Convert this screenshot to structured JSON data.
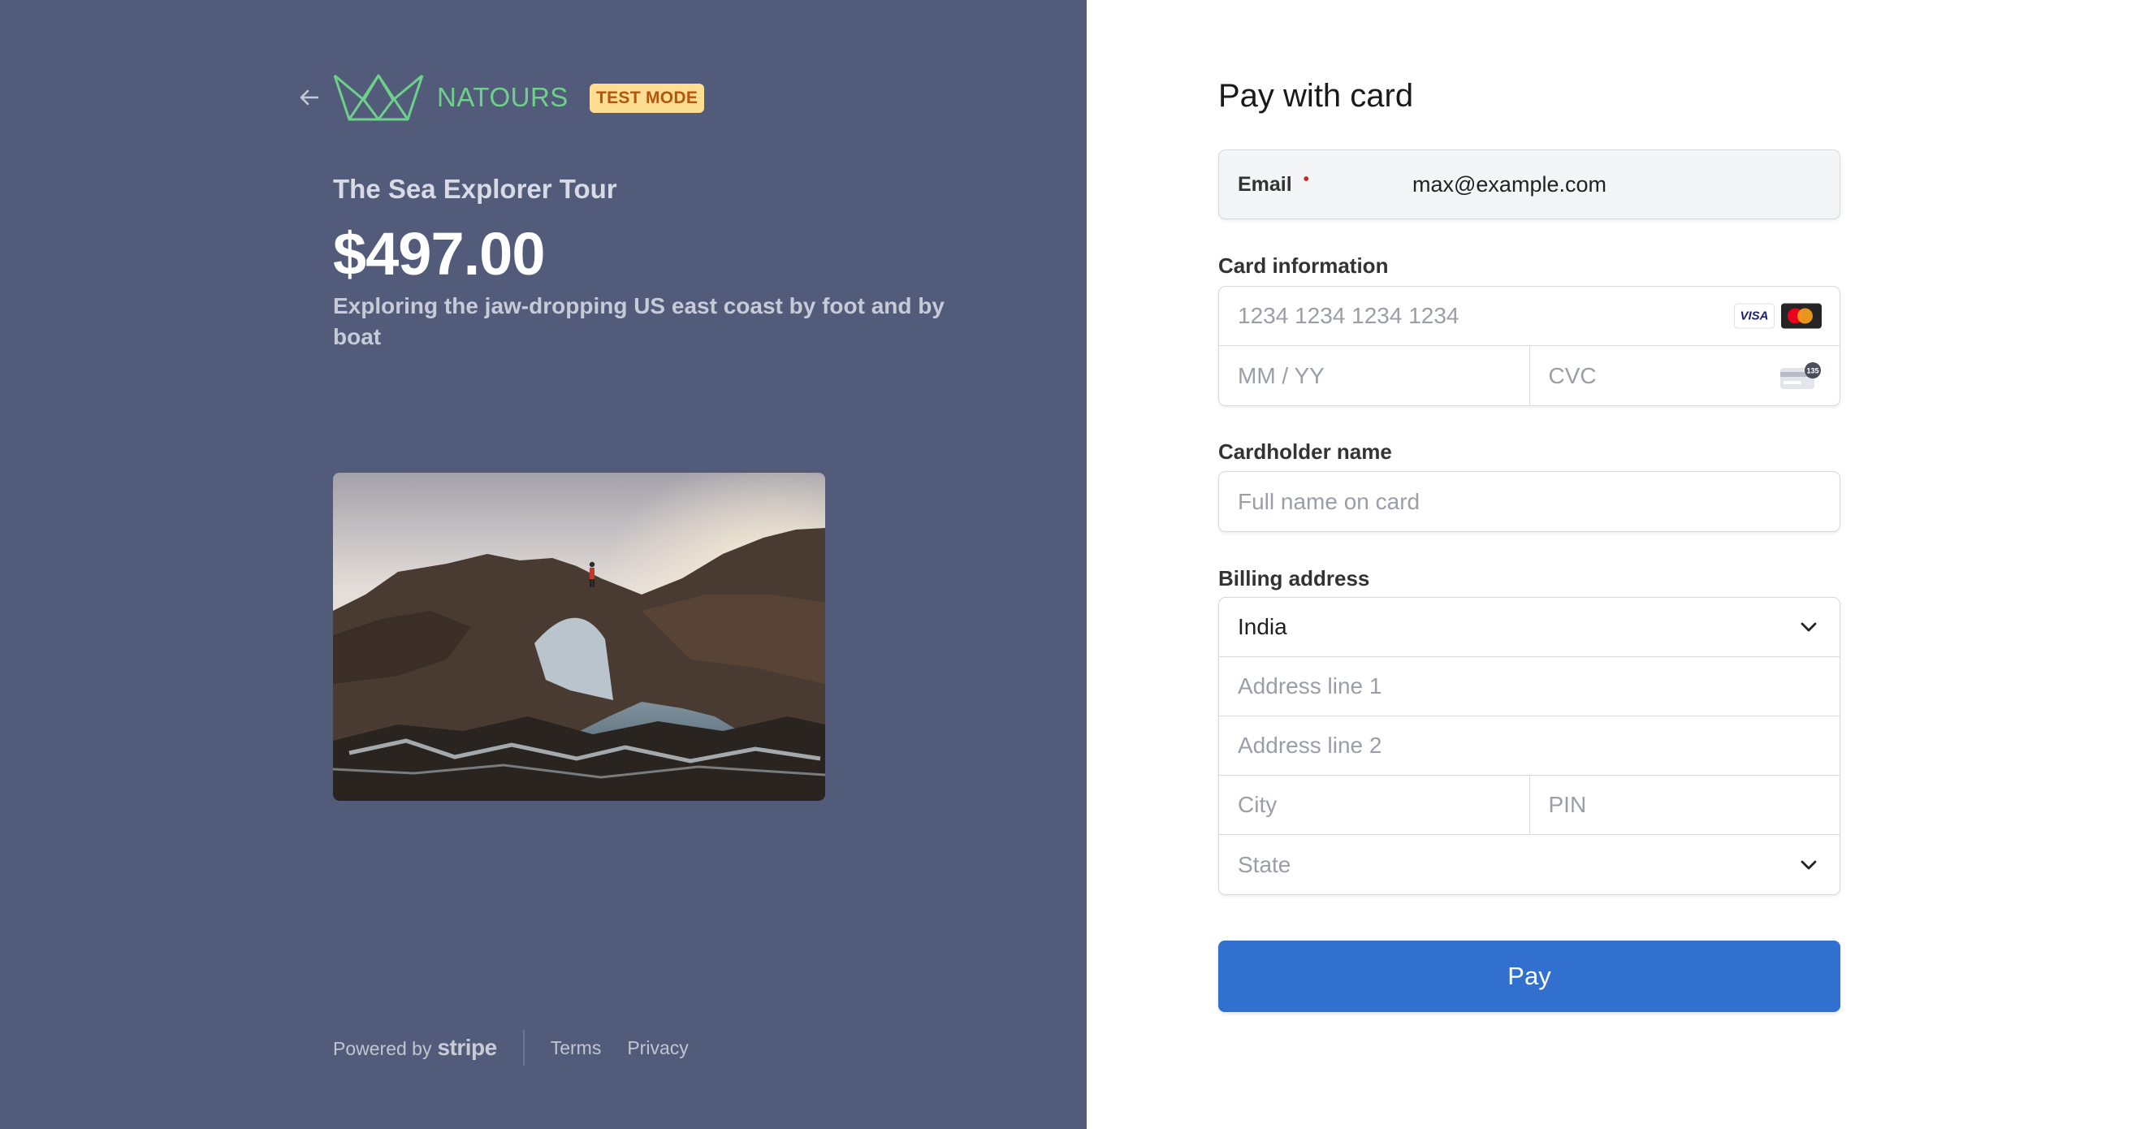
{
  "summary": {
    "brand": "NATOURS",
    "test_mode_badge": "TEST MODE",
    "product_name": "The Sea Explorer Tour",
    "price": "$497.00",
    "description": "Exploring the jaw-dropping US east coast by foot and by boat",
    "image_icon": "tour-photo"
  },
  "footer": {
    "powered_by": "Powered by",
    "stripe": "stripe",
    "terms": "Terms",
    "privacy": "Privacy"
  },
  "form": {
    "title": "Pay with card",
    "email": {
      "label": "Email",
      "value": "max@example.com"
    },
    "card": {
      "label": "Card information",
      "number_placeholder": "1234 1234 1234 1234",
      "expiry_placeholder": "MM / YY",
      "cvc_placeholder": "CVC",
      "brand_visa": "VISA",
      "cvc_hint": "135"
    },
    "cardholder": {
      "label": "Cardholder name",
      "placeholder": "Full name on card"
    },
    "billing": {
      "label": "Billing address",
      "country": "India",
      "line1_placeholder": "Address line 1",
      "line2_placeholder": "Address line 2",
      "city_placeholder": "City",
      "pin_placeholder": "PIN",
      "state_placeholder": "State"
    },
    "pay_label": "Pay"
  },
  "colors": {
    "left_panel": "#525c7a",
    "brand_green": "#6fd08c",
    "badge_bg": "#ffde92",
    "pay_button": "#3270d0"
  }
}
